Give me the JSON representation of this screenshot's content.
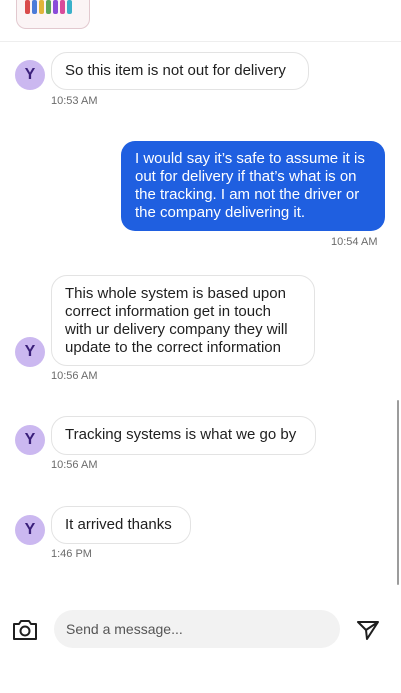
{
  "contact": {
    "avatar_initial": "Y"
  },
  "messages": [
    {
      "from": "them",
      "text": "So this item is not out for delivery",
      "time": "10:53 AM"
    },
    {
      "from": "me",
      "lines": [
        "I would say it’s safe to assume it is",
        "out for delivery if that’s what is on",
        "the tracking. I am not the driver or",
        "the company delivering it."
      ],
      "time": "10:54 AM"
    },
    {
      "from": "them",
      "lines": [
        "This whole system is based upon",
        "correct information get in touch",
        "with ur delivery company they will",
        "update to the correct information"
      ],
      "time": "10:56 AM"
    },
    {
      "from": "them",
      "text": "Tracking systems is what we go by",
      "time": "10:56 AM"
    },
    {
      "from": "them",
      "text": "It arrived thanks",
      "time": "1:46 PM"
    }
  ],
  "composer": {
    "placeholder": "Send a message..."
  },
  "colors": {
    "outgoing_bubble": "#1f5fe0",
    "avatar_bg": "#cbb8f0",
    "avatar_text": "#3a1f7a"
  },
  "icons": {
    "camera": "camera-icon",
    "send": "send-icon"
  }
}
